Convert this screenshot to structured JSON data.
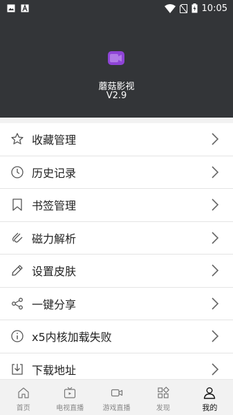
{
  "status_bar": {
    "time": "10:05",
    "icons": [
      "image-icon",
      "a-icon",
      "wifi-icon",
      "no-sim-icon",
      "battery-charging-icon"
    ]
  },
  "header": {
    "app_name": "蘑菇影视",
    "version": "V2.9",
    "logo_color": "#8e44d6"
  },
  "menu": {
    "items": [
      {
        "label": "收藏管理",
        "icon": "star-icon"
      },
      {
        "label": "历史记录",
        "icon": "clock-icon"
      },
      {
        "label": "书签管理",
        "icon": "bookmark-icon"
      },
      {
        "label": "磁力解析",
        "icon": "magnet-icon"
      },
      {
        "label": "设置皮肤",
        "icon": "pencil-icon"
      },
      {
        "label": "一键分享",
        "icon": "share-icon"
      },
      {
        "label": "x5内核加载失败",
        "icon": "info-icon"
      },
      {
        "label": "下载地址",
        "icon": "download-icon"
      }
    ]
  },
  "bottom_nav": {
    "items": [
      {
        "label": "首页",
        "icon": "home-icon",
        "active": false
      },
      {
        "label": "电视直播",
        "icon": "tv-icon",
        "active": false
      },
      {
        "label": "游戏直播",
        "icon": "camera-icon",
        "active": false
      },
      {
        "label": "发现",
        "icon": "grid-icon",
        "active": false
      },
      {
        "label": "我的",
        "icon": "user-icon",
        "active": true
      }
    ]
  }
}
